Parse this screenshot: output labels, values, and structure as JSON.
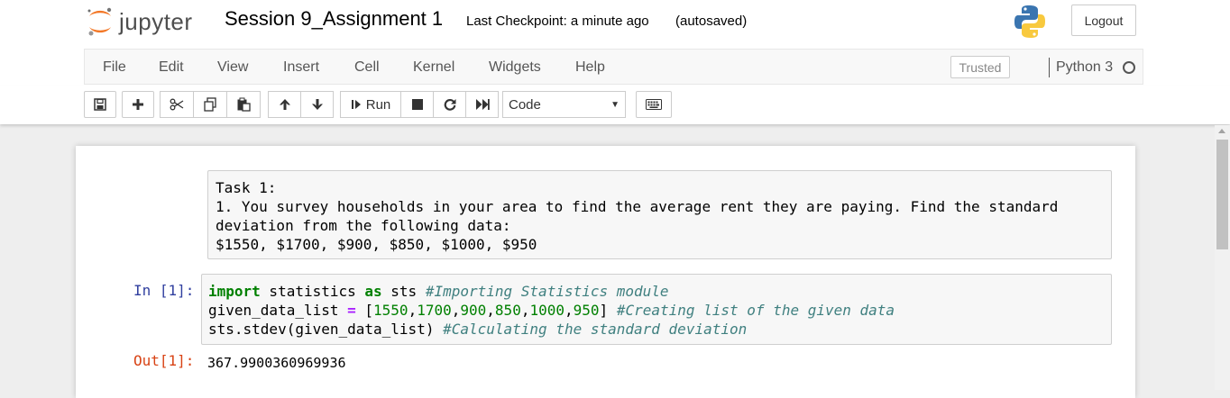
{
  "header": {
    "logo_text": "jupyter",
    "notebook_name": "Session 9_Assignment 1",
    "checkpoint": "Last Checkpoint: a minute ago",
    "autosave": "(autosaved)",
    "logout_label": "Logout"
  },
  "menu": {
    "items": [
      "File",
      "Edit",
      "View",
      "Insert",
      "Cell",
      "Kernel",
      "Widgets",
      "Help"
    ],
    "trusted_label": "Trusted",
    "kernel_name": "Python 3"
  },
  "toolbar": {
    "run_label": "Run",
    "cell_type": "Code"
  },
  "cells": {
    "markdown": {
      "lines": [
        "Task 1:",
        "1. You survey households in your area to find the average rent they are paying. Find the standard",
        "deviation from the following data:",
        "$1550, $1700, $900, $850, $1000, $950"
      ]
    },
    "code": {
      "prompt": "In [1]:",
      "line1": {
        "kw1": "import",
        "mid1": " statistics ",
        "kw2": "as",
        "mid2": " sts ",
        "comment": "#Importing Statistics module"
      },
      "line2": {
        "name": "given_data_list ",
        "eq": "=",
        "open": " [",
        "n1": "1550",
        "n2": "1700",
        "n3": "900",
        "n4": "850",
        "n5": "1000",
        "n6": "950",
        "close": "] ",
        "comment": "#Creating list of the given data"
      },
      "line3": {
        "code": "sts.stdev(given_data_list) ",
        "comment": "#Calculating the standard deviation"
      }
    },
    "output": {
      "prompt": "Out[1]:",
      "value": "367.9900360969936"
    }
  },
  "colors": {
    "in_prompt": "#303f9f",
    "out_prompt": "#d84315",
    "keyword": "#008000",
    "operator": "#aa22ff",
    "comment": "#408080",
    "logo_orange": "#f37726"
  },
  "icons": [
    "jupyter-logo-icon",
    "python-logo-icon",
    "save-icon",
    "plus-icon",
    "cut-icon",
    "copy-icon",
    "paste-icon",
    "arrow-up-icon",
    "arrow-down-icon",
    "run-icon",
    "stop-icon",
    "restart-icon",
    "fast-forward-icon",
    "keyboard-icon"
  ]
}
